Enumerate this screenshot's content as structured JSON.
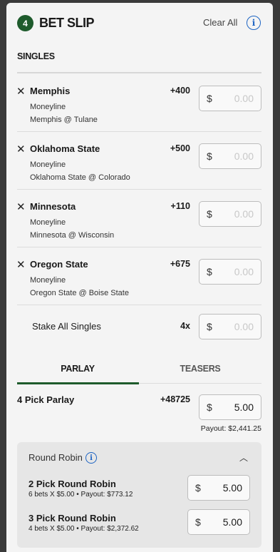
{
  "header": {
    "count_badge": "4",
    "title": "BET SLIP",
    "clear_all": "Clear All",
    "info_glyph": "i"
  },
  "singles": {
    "section_title": "SINGLES",
    "selections": [
      {
        "team": "Memphis",
        "odds": "+400",
        "market": "Moneyline",
        "matchup": "Memphis @ Tulane",
        "currency": "$",
        "placeholder": "0.00"
      },
      {
        "team": "Oklahoma State",
        "odds": "+500",
        "market": "Moneyline",
        "matchup": "Oklahoma State @ Colorado",
        "currency": "$",
        "placeholder": "0.00"
      },
      {
        "team": "Minnesota",
        "odds": "+110",
        "market": "Moneyline",
        "matchup": "Minnesota @ Wisconsin",
        "currency": "$",
        "placeholder": "0.00"
      },
      {
        "team": "Oregon State",
        "odds": "+675",
        "market": "Moneyline",
        "matchup": "Oregon State @ Boise State",
        "currency": "$",
        "placeholder": "0.00"
      }
    ],
    "stake_all": {
      "label": "Stake All Singles",
      "multiplier": "4x",
      "currency": "$",
      "placeholder": "0.00"
    }
  },
  "tabs": [
    {
      "label": "PARLAY",
      "active": true
    },
    {
      "label": "TEASERS",
      "active": false
    }
  ],
  "parlay": {
    "label": "4 Pick Parlay",
    "odds": "+48725",
    "currency": "$",
    "stake": "5.00",
    "payout": "Payout: $2,441.25"
  },
  "round_robin": {
    "title": "Round Robin",
    "chevron_glyph": "︿",
    "items": [
      {
        "label": "2 Pick Round Robin",
        "detail": "6 bets X $5.00 • Payout: $773.12",
        "currency": "$",
        "stake": "5.00"
      },
      {
        "label": "3 Pick Round Robin",
        "detail": "4 bets X $5.00 • Payout: $2,372.62",
        "currency": "$",
        "stake": "5.00"
      }
    ]
  },
  "icons": {
    "remove": "✕"
  },
  "colors": {
    "brand_green": "#1e5b2c",
    "info_blue": "#1d64c3"
  }
}
